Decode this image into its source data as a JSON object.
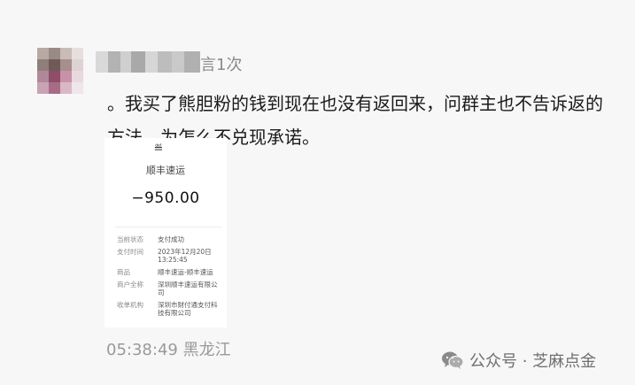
{
  "post": {
    "author_suffix": "言1次",
    "message": "。我买了熊胆粉的钱到现在也没有返回来，问群主也不告诉返的方法。为怎么不兑现承诺。",
    "timestamp": "05:38:49 黑龙江"
  },
  "receipt": {
    "logo_glyph": "≝",
    "merchant": "顺丰速运",
    "amount": "−950.00",
    "rows": [
      {
        "key": "当前状态",
        "value": "支付成功"
      },
      {
        "key": "支付时间",
        "value": "2023年12月20日 13:25:45"
      },
      {
        "key": "商品",
        "value": "顺丰速运-顺丰速运"
      },
      {
        "key": "商户全称",
        "value": "深圳顺丰速运有限公司"
      },
      {
        "key": "收单机构",
        "value": "深圳市财付通支付科技有限公司"
      }
    ]
  },
  "watermark": {
    "icon": "wechat-icon",
    "text": "公众号 · 芝麻点金"
  },
  "colors": {
    "background": "#f7f7f7",
    "text": "#1a1a1a",
    "muted": "#9a9a9a"
  }
}
